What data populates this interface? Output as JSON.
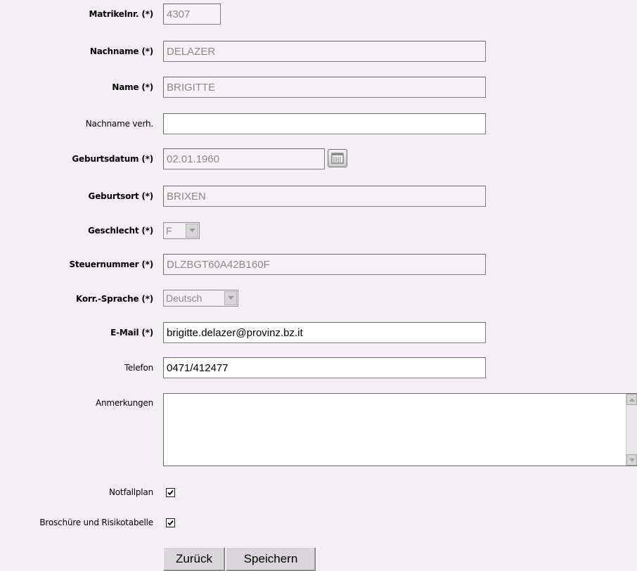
{
  "form": {
    "matrikelnr": {
      "label": "Matrikelnr. (*)",
      "value": "4307"
    },
    "nachname": {
      "label": "Nachname (*)",
      "value": "DELAZER"
    },
    "name": {
      "label": "Name (*)",
      "value": "BRIGITTE"
    },
    "nachname_verh": {
      "label": "Nachname verh.",
      "value": ""
    },
    "geburtsdatum": {
      "label": "Geburtsdatum (*)",
      "value": "02.01.1960",
      "icon": "calendar-icon"
    },
    "geburtsort": {
      "label": "Geburtsort (*)",
      "value": "BRIXEN"
    },
    "geschlecht": {
      "label": "Geschlecht (*)",
      "value": "F"
    },
    "steuernummer": {
      "label": "Steuernummer (*)",
      "value": "DLZBGT60A42B160F"
    },
    "korr_sprache": {
      "label": "Korr.-Sprache (*)",
      "value": "Deutsch"
    },
    "email": {
      "label": "E-Mail (*)",
      "value": "brigitte.delazer@provinz.bz.it"
    },
    "telefon": {
      "label": "Telefon",
      "value": "0471/412477"
    },
    "anmerkungen": {
      "label": "Anmerkungen",
      "value": ""
    },
    "notfallplan": {
      "label": "Notfallplan",
      "checked": true
    },
    "broschuere": {
      "label": "Broschüre und Risikotabelle",
      "checked": true
    }
  },
  "buttons": {
    "back": "Zurück",
    "save": "Speichern"
  },
  "colors": {
    "background": "#f4eff4",
    "disabled_text": "#8a8a8a"
  }
}
